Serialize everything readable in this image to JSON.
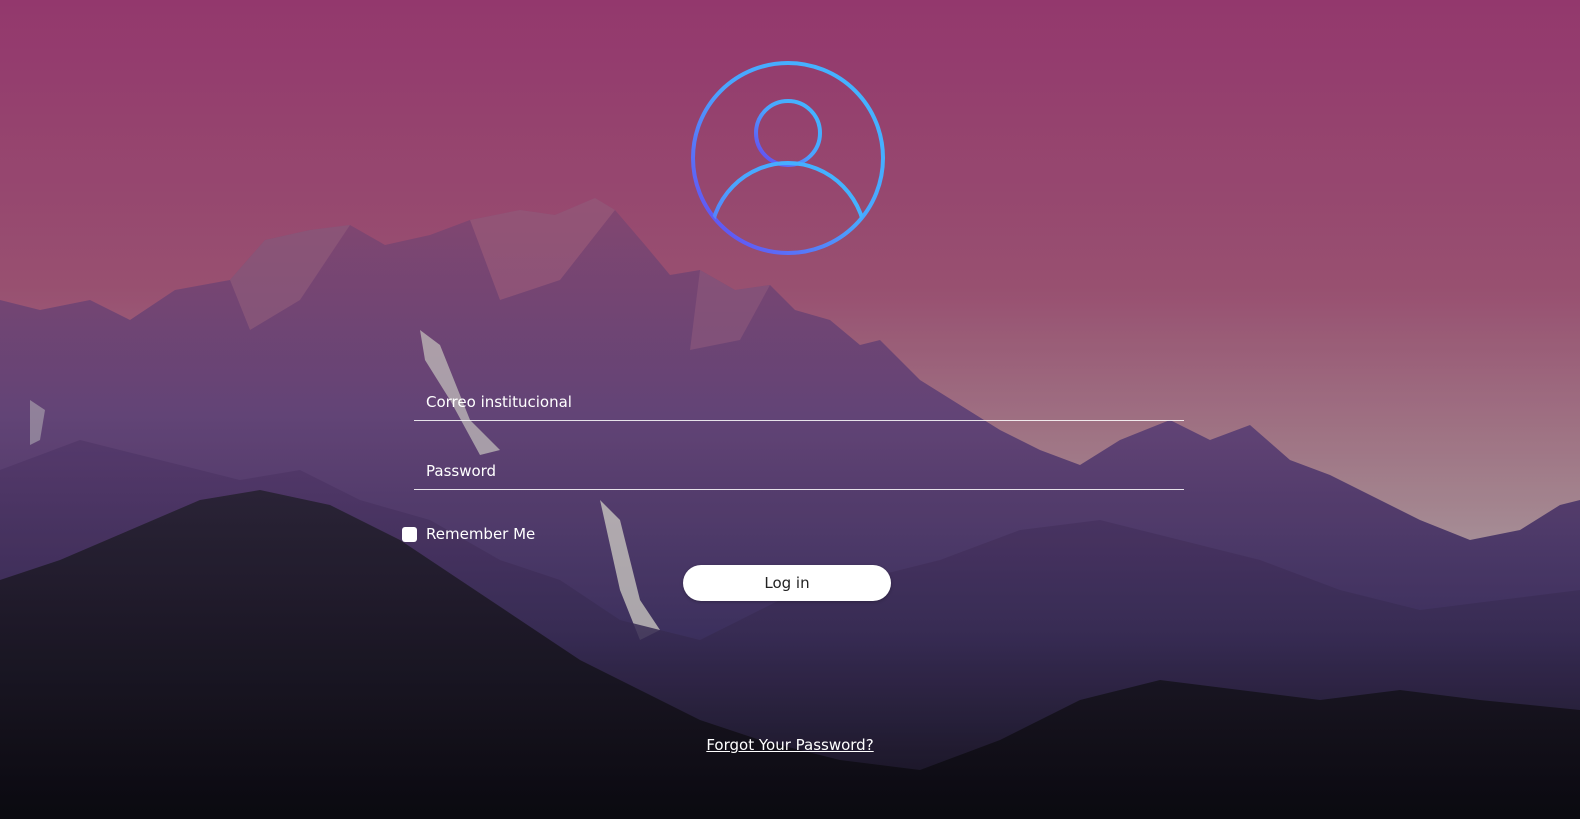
{
  "form": {
    "email_placeholder": "Correo institucional",
    "password_placeholder": "Password",
    "remember_label": "Remember Me",
    "login_label": "Log in",
    "forgot_label": "Forgot Your Password?"
  },
  "icons": {
    "avatar": "user-circle-icon",
    "checkbox": "checkbox-unchecked"
  },
  "colors": {
    "sky_top": "#a03e78",
    "sky_bottom": "#b9aab1",
    "avatar_gradient_start": "#42b8ff",
    "avatar_gradient_end": "#6a3cf0",
    "button_bg": "#ffffff",
    "text": "#ffffff"
  }
}
